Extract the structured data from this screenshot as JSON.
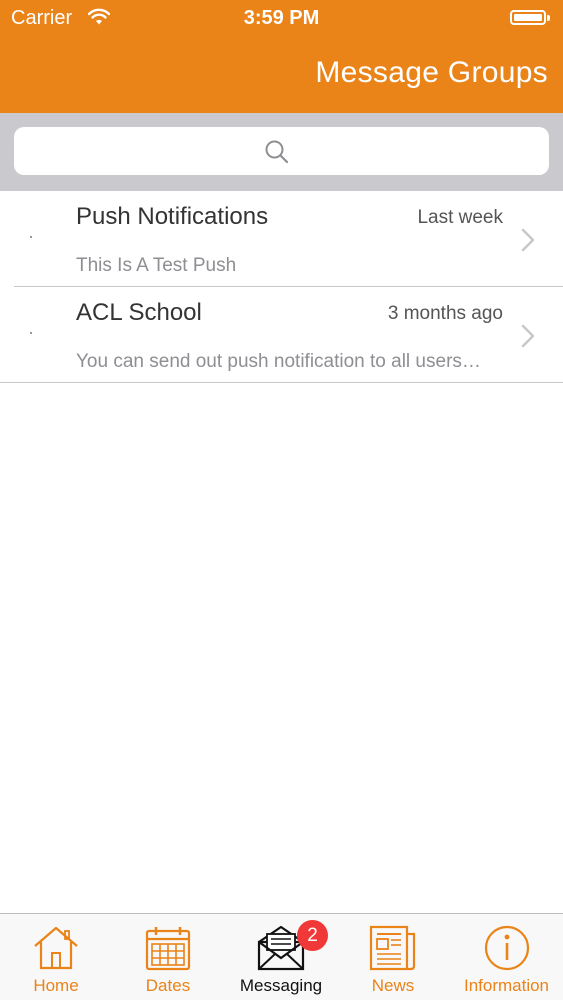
{
  "status_bar": {
    "carrier": "Carrier",
    "time": "3:59 PM"
  },
  "header": {
    "title": "Message Groups"
  },
  "search": {
    "placeholder": ""
  },
  "groups": [
    {
      "title": "Push Notifications",
      "time": "Last week",
      "subtitle": "This Is A Test Push"
    },
    {
      "title": "ACL School",
      "time": "3 months ago",
      "subtitle": "You can send out push notification to all users…"
    }
  ],
  "tabbar": {
    "active": "Messaging",
    "badge": "2",
    "tabs": [
      {
        "label": "Home",
        "icon": "home-icon"
      },
      {
        "label": "Dates",
        "icon": "calendar-icon"
      },
      {
        "label": "Messaging",
        "icon": "envelope-icon"
      },
      {
        "label": "News",
        "icon": "newspaper-icon"
      },
      {
        "label": "Information",
        "icon": "info-icon"
      }
    ]
  },
  "colors": {
    "accent": "#ea8318",
    "search_bg": "#c9c9ce",
    "badge": "#f03838",
    "tabbar_bg": "#f8f8f8"
  }
}
